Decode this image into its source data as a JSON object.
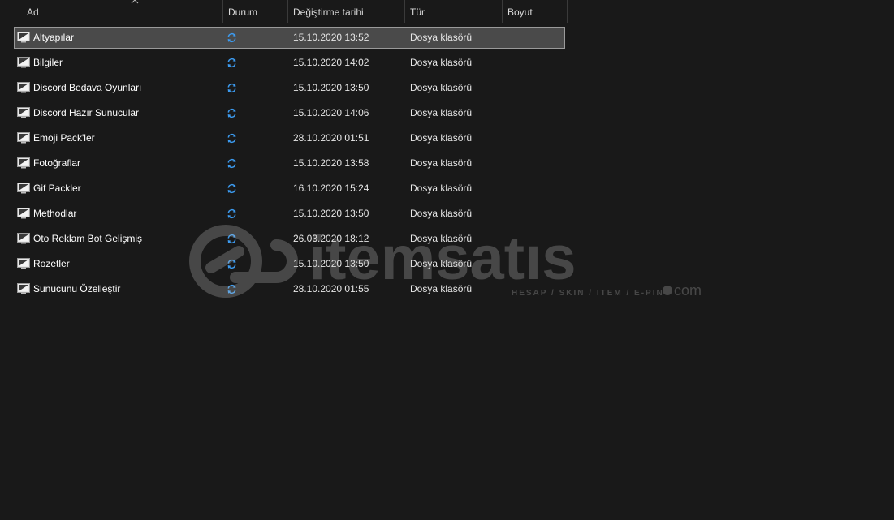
{
  "columns": {
    "name": "Ad",
    "status": "Durum",
    "date": "Değiştirme tarihi",
    "type": "Tür",
    "size": "Boyut"
  },
  "sort": {
    "column": "name",
    "direction": "ascending",
    "icon": "sort-up-icon"
  },
  "rows": [
    {
      "name": "Altyapılar",
      "status_icon": "sync-icon",
      "date": "15.10.2020 13:52",
      "type": "Dosya klasörü",
      "size": "",
      "selected": true
    },
    {
      "name": "Bilgiler",
      "status_icon": "sync-icon",
      "date": "15.10.2020 14:02",
      "type": "Dosya klasörü",
      "size": ""
    },
    {
      "name": "Discord Bedava Oyunları",
      "status_icon": "sync-icon",
      "date": "15.10.2020 13:50",
      "type": "Dosya klasörü",
      "size": ""
    },
    {
      "name": "Discord Hazır Sunucular",
      "status_icon": "sync-icon",
      "date": "15.10.2020 14:06",
      "type": "Dosya klasörü",
      "size": ""
    },
    {
      "name": "Emoji Pack'ler",
      "status_icon": "sync-icon",
      "date": "28.10.2020 01:51",
      "type": "Dosya klasörü",
      "size": ""
    },
    {
      "name": "Fotoğraflar",
      "status_icon": "sync-icon",
      "date": "15.10.2020 13:58",
      "type": "Dosya klasörü",
      "size": ""
    },
    {
      "name": "Gif Packler",
      "status_icon": "sync-icon",
      "date": "16.10.2020 15:24",
      "type": "Dosya klasörü",
      "size": ""
    },
    {
      "name": "Methodlar",
      "status_icon": "sync-icon",
      "date": "15.10.2020 13:50",
      "type": "Dosya klasörü",
      "size": ""
    },
    {
      "name": "Oto Reklam Bot Gelişmiş",
      "status_icon": "sync-icon",
      "date": "26.03.2020 18:12",
      "type": "Dosya klasörü",
      "size": ""
    },
    {
      "name": "Rozetler",
      "status_icon": "sync-icon",
      "date": "15.10.2020 13:50",
      "type": "Dosya klasörü",
      "size": ""
    },
    {
      "name": "Sunucunu Özelleştir",
      "status_icon": "sync-icon",
      "date": "28.10.2020 01:55",
      "type": "Dosya klasörü",
      "size": ""
    }
  ],
  "watermark": {
    "brand": "itemsatıs",
    "tagline": "HESAP / SKIN / ITEM / E-PIN",
    "suffix": "com"
  },
  "colors": {
    "background": "#191919",
    "selected_row": "#4a4a4a",
    "selected_border": "#9a9a9a",
    "sync_icon": "#3c9bf0",
    "header_text": "#d9d9d9"
  }
}
